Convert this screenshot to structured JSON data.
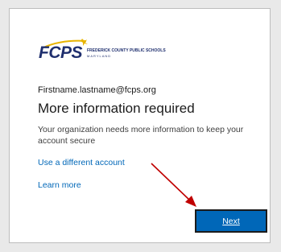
{
  "logo": {
    "abbr": "FCPS",
    "name": "FREDERICK COUNTY PUBLIC SCHOOLS",
    "state": "MARYLAND"
  },
  "account_email": "Firstname.lastname@fcps.org",
  "heading": "More information required",
  "description": "Your organization needs more information to keep your account secure",
  "links": {
    "different_account": "Use a different account",
    "learn_more": "Learn more"
  },
  "next_button": "Next",
  "colors": {
    "accent": "#0067b8",
    "logo_navy": "#1f2f6e",
    "logo_gold": "#e8b400",
    "annotation_arrow": "#c00000"
  },
  "icons": [
    "swoosh-icon",
    "annotation-arrow-icon"
  ]
}
